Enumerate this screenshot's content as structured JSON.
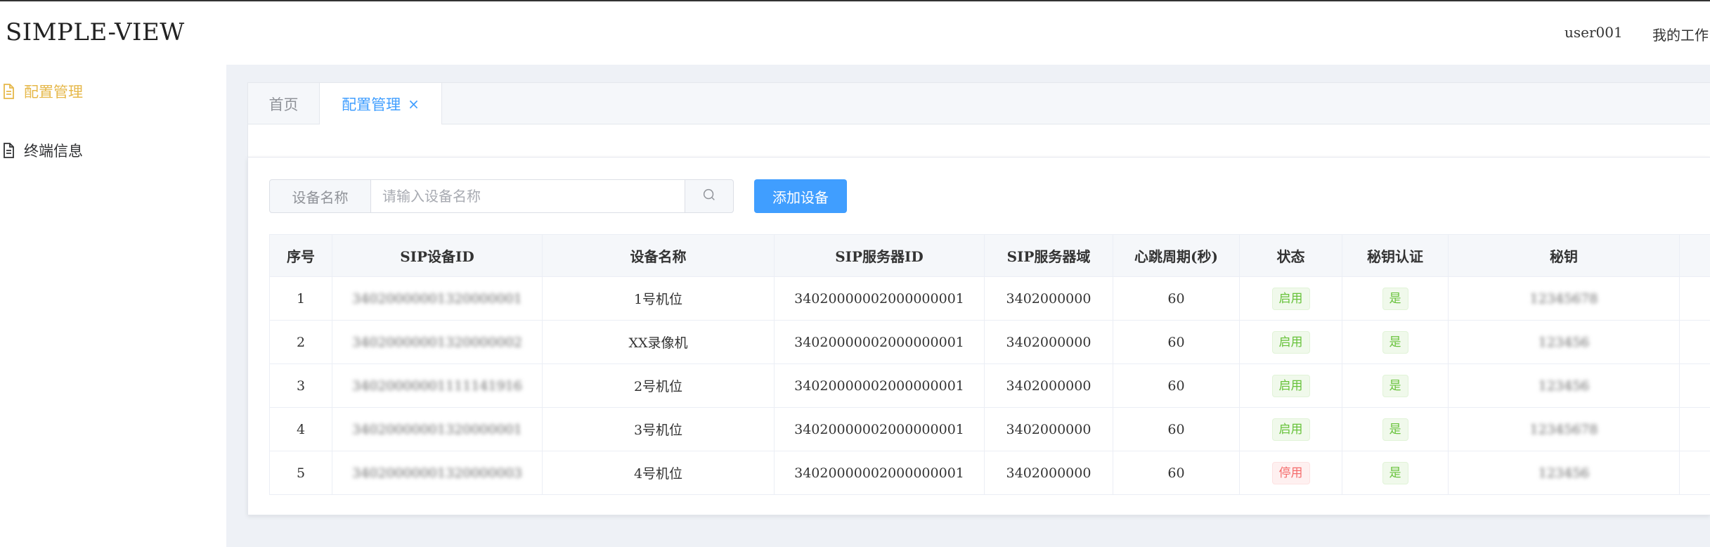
{
  "header": {
    "brand": "SIMPLE-VIEW",
    "user": "user001",
    "workspace": "我的工作台"
  },
  "sidebar": {
    "items": [
      {
        "label": "配置管理",
        "active": true
      },
      {
        "label": "终端信息",
        "active": false
      }
    ]
  },
  "tabs": {
    "home": "首页",
    "current": "配置管理",
    "close": "×"
  },
  "search": {
    "label": "设备名称",
    "placeholder": "请输入设备名称",
    "add_label": "添加设备"
  },
  "table": {
    "headers": [
      "序号",
      "SIP设备ID",
      "设备名称",
      "SIP服务器ID",
      "SIP服务器域",
      "心跳周期(秒)",
      "状态",
      "秘钥认证",
      "秘钥",
      ""
    ],
    "rows": [
      {
        "index": "1",
        "sip_id": "34020000001320000001",
        "name": "1号机位",
        "server_id": "34020000002000000001",
        "domain": "3402000000",
        "heartbeat": "60",
        "status": "启用",
        "auth": "是",
        "secret": "12345678"
      },
      {
        "index": "2",
        "sip_id": "34020000001320000002",
        "name": "XX录像机",
        "server_id": "34020000002000000001",
        "domain": "3402000000",
        "heartbeat": "60",
        "status": "启用",
        "auth": "是",
        "secret": "123456"
      },
      {
        "index": "3",
        "sip_id": "34020000001111141916",
        "name": "2号机位",
        "server_id": "34020000002000000001",
        "domain": "3402000000",
        "heartbeat": "60",
        "status": "启用",
        "auth": "是",
        "secret": "123456"
      },
      {
        "index": "4",
        "sip_id": "34020000001320000001",
        "name": "3号机位",
        "server_id": "34020000002000000001",
        "domain": "3402000000",
        "heartbeat": "60",
        "status": "启用",
        "auth": "是",
        "secret": "12345678"
      },
      {
        "index": "5",
        "sip_id": "34020000001320000003",
        "name": "4号机位",
        "server_id": "34020000002000000001",
        "domain": "3402000000",
        "heartbeat": "60",
        "status": "停用",
        "auth": "是",
        "secret": "123456"
      }
    ]
  },
  "colors": {
    "accent": "#409eff",
    "active_nav": "#e6b84a",
    "success": "#67c23a",
    "danger": "#f56c6c"
  }
}
